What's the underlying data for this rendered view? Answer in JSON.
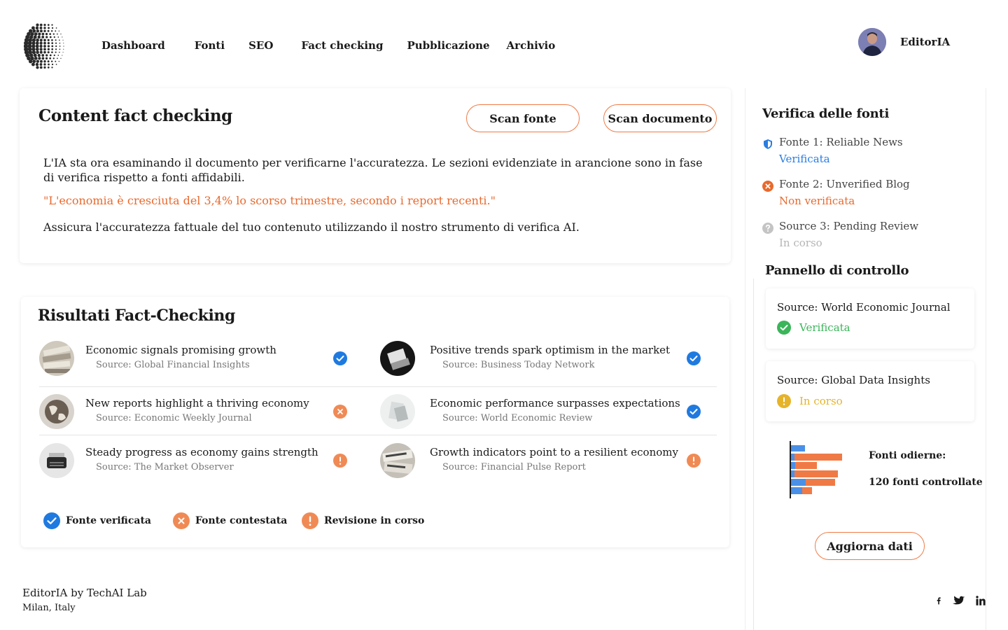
{
  "nav": {
    "items": [
      "Dashboard",
      "Fonti",
      "SEO",
      "Fact checking",
      "Pubblicazione",
      "Archivio"
    ]
  },
  "user": {
    "name": "EditorIA"
  },
  "content_check": {
    "title": "Content fact checking",
    "scan_source_label": "Scan fonte",
    "scan_document_label": "Scan documento",
    "paragraph": "L'IA sta ora esaminando il documento per verificarne l'accuratezza. Le sezioni evidenziate in arancione sono in fase di verifica rispetto a fonti affidabili.",
    "highlight": "\"L'economia è cresciuta del 3,4% lo scorso trimestre, secondo i report recenti.\"",
    "closing": "Assicura l'accuratezza fattuale del tuo contenuto utilizzando il nostro strumento di verifica AI."
  },
  "results": {
    "title": "Risultati Fact-Checking",
    "items": [
      {
        "title": "Economic signals promising growth",
        "source": "Source: Global Financial Insights",
        "status": "verified",
        "thumb": "newspaper-stack-icon"
      },
      {
        "title": "Positive trends spark optimism in the market",
        "source": "Source: Business Today Network",
        "status": "verified",
        "thumb": "laptop-desk-icon"
      },
      {
        "title": "New reports highlight a thriving economy",
        "source": "Source: Economic Weekly Journal",
        "status": "contested",
        "thumb": "globe-icon"
      },
      {
        "title": "Economic performance surpasses expectations",
        "source": "Source: World Economic Review",
        "status": "verified",
        "thumb": "document-icon"
      },
      {
        "title": "Steady progress as economy gains strength",
        "source": "Source: The Market Observer",
        "status": "review",
        "thumb": "typewriter-icon"
      },
      {
        "title": "Growth indicators point to a resilient economy",
        "source": "Source: Financial Pulse Report",
        "status": "review",
        "thumb": "newspaper-icon"
      }
    ],
    "legend": {
      "verified": "Fonte verificata",
      "contested": "Fonte contestata",
      "review": "Revisione in corso"
    }
  },
  "footer": {
    "brand": "EditorIA by TechAI Lab",
    "location": "Milan, Italy",
    "social": [
      "facebook-icon",
      "twitter-icon",
      "linkedin-icon"
    ]
  },
  "sidebar": {
    "verify_title": "Verifica delle fonti",
    "sources": [
      {
        "name": "Fonte 1: Reliable News",
        "status": "Verificata",
        "color": "#2a7de1"
      },
      {
        "name": "Fonte 2: Unverified Blog",
        "status": "Non verificata",
        "color": "#e8692c"
      },
      {
        "name": "Source 3: Pending Review",
        "status": "In corso",
        "color": "#b5b5b5"
      }
    ],
    "panel_title": "Pannello di controllo",
    "panel_cards": [
      {
        "name": "Source: World Economic Journal",
        "status": "Verificata",
        "color": "#3bb55a"
      },
      {
        "name": "Source: Global Data Insights",
        "status": "In corso",
        "color": "#e5b42a"
      }
    ],
    "today_label": "Fonti odierne:",
    "today_count": "120 fonti controllate",
    "update_label": "Aggiorna dati"
  },
  "colors": {
    "accent": "#f07a45",
    "verified_blue": "#1f7ae0",
    "contested_orange": "#f08a55",
    "highlight_orange": "#e86a2e"
  }
}
